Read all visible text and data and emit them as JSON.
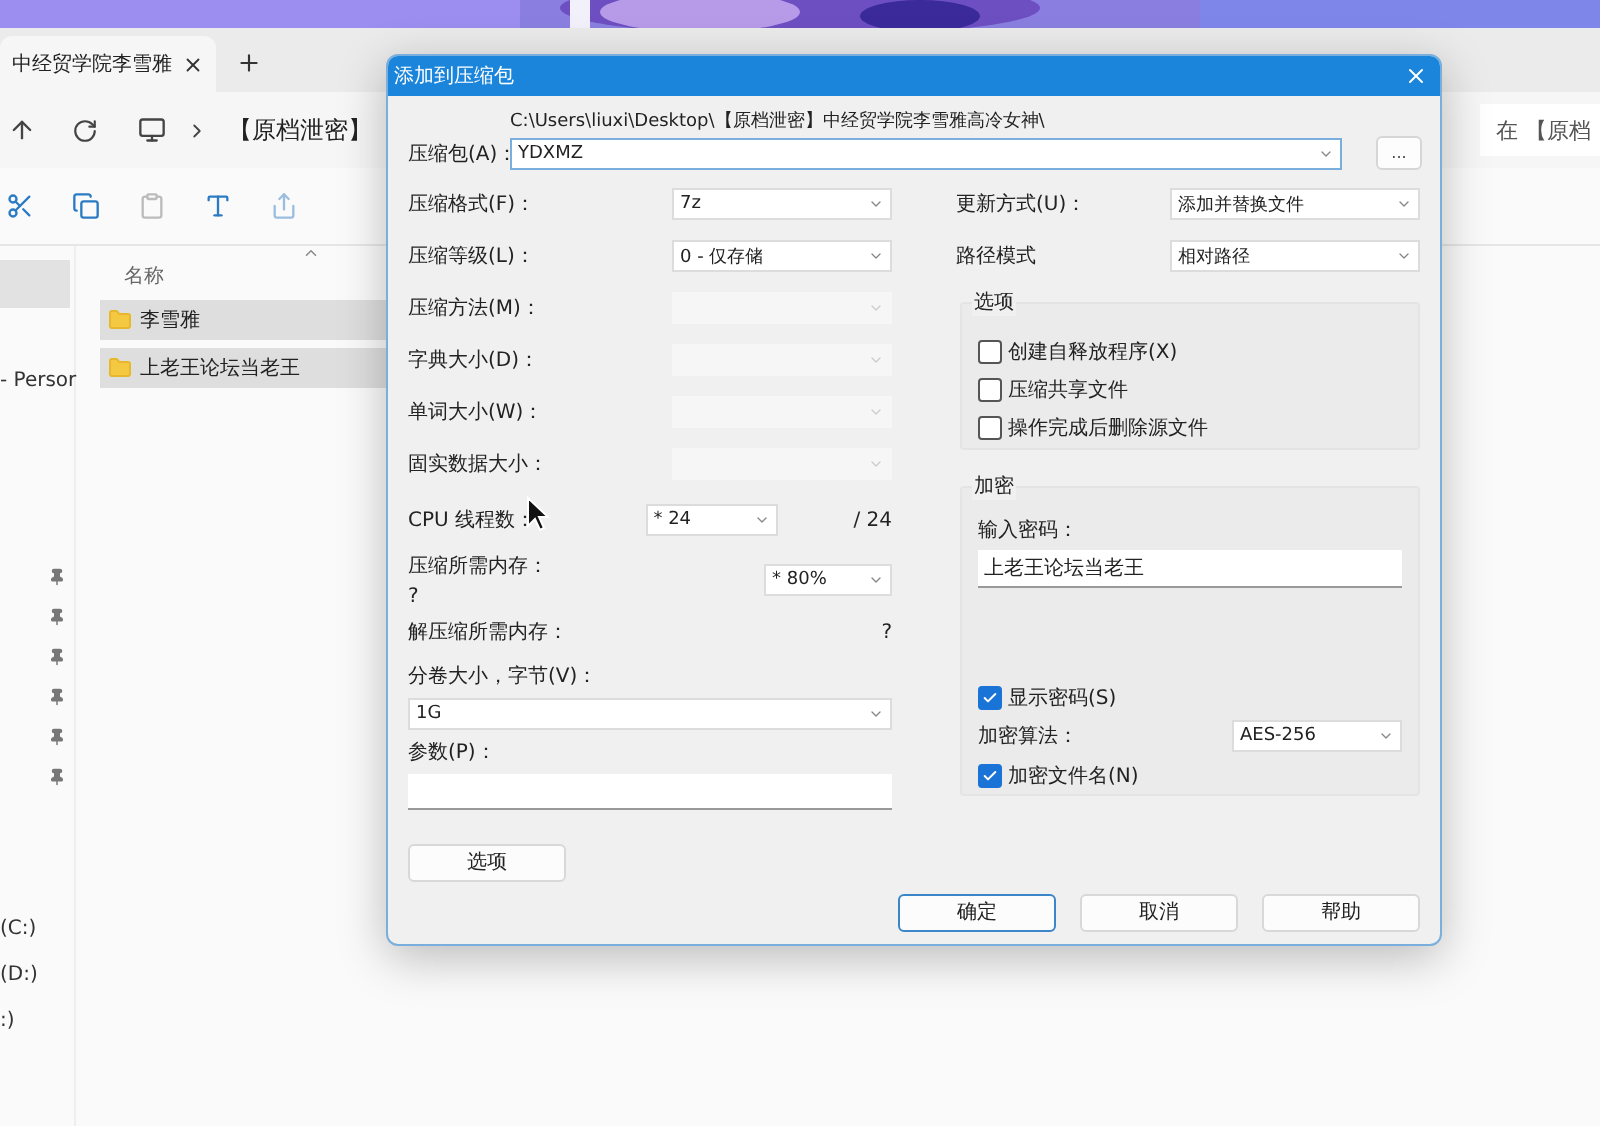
{
  "explorer": {
    "tab_title": "中经贸学院李雪雅",
    "address": "【原档泄密】",
    "search": "在 【原档",
    "column_header": "名称",
    "files": [
      {
        "name": "李雪雅",
        "selected": true
      },
      {
        "name": "上老王论坛当老王",
        "selected": true
      }
    ],
    "sidebar": {
      "label": "- Persor",
      "pinned": [
        true,
        true,
        true,
        true,
        true,
        true
      ],
      "drives": [
        "(C:)",
        "(D:)",
        ":)"
      ]
    }
  },
  "dialog": {
    "title": "添加到压缩包",
    "archive": {
      "label": "压缩包(A)：",
      "path": "C:\\Users\\liuxi\\Desktop\\【原档泄密】中经贸学院李雪雅高冷女神\\",
      "value": "YDXMZ",
      "browse": "..."
    },
    "left_fields": [
      {
        "kind": "combo",
        "label": "压缩格式(F)：",
        "value": "7z",
        "disabled": false
      },
      {
        "kind": "combo",
        "label": "压缩等级(L)：",
        "value": "0 - 仅存储",
        "disabled": false
      },
      {
        "kind": "combo",
        "label": "压缩方法(M)：",
        "disabled": true
      },
      {
        "kind": "combo",
        "label": "字典大小(D)：",
        "disabled": true
      },
      {
        "kind": "combo",
        "label": "单词大小(W)：",
        "disabled": true
      },
      {
        "kind": "combo",
        "label": "固实数据大小：",
        "disabled": true
      },
      {
        "kind": "threads",
        "label": "CPU 线程数：",
        "value": "* 24",
        "suffix": "/ 24"
      },
      {
        "kind": "memory",
        "label": "压缩所需内存：",
        "note": "?",
        "value": "* 80%"
      },
      {
        "kind": "info",
        "label": "解压缩所需内存：",
        "note": "?"
      },
      {
        "kind": "wide_combo",
        "label": "分卷大小，字节(V)：",
        "value": "1G"
      },
      {
        "kind": "wide_input",
        "label": "参数(P)："
      }
    ],
    "options_button": "选项",
    "right_fields": [
      {
        "label": "更新方式(U)：",
        "value": "添加并替换文件"
      },
      {
        "label": "路径模式",
        "value": "相对路径"
      }
    ],
    "options_group": {
      "title": "选项",
      "checkboxes": [
        {
          "label": "创建自释放程序(X)",
          "checked": false
        },
        {
          "label": "压缩共享文件",
          "checked": false
        },
        {
          "label": "操作完成后删除源文件",
          "checked": false
        }
      ]
    },
    "encryption": {
      "title": "加密",
      "password_label": "输入密码：",
      "password": "上老王论坛当老王",
      "show_password": {
        "label": "显示密码(S)",
        "checked": true
      },
      "method_label": "加密算法：",
      "method": "AES-256",
      "encrypt_names": {
        "label": "加密文件名(N)",
        "checked": true
      }
    },
    "buttons": [
      {
        "label": "确定",
        "default": true
      },
      {
        "label": "取消",
        "default": false
      },
      {
        "label": "帮助",
        "default": false
      }
    ]
  }
}
